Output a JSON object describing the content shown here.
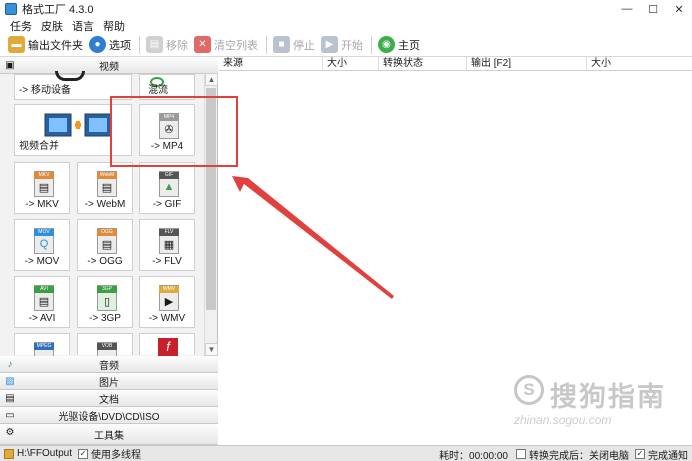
{
  "window": {
    "title": "格式工厂 4.3.0",
    "minimize": "—",
    "maximize": "☐",
    "close": "✕"
  },
  "menu": [
    "任务",
    "皮肤",
    "语言",
    "帮助"
  ],
  "toolbar": {
    "output_folder": "输出文件夹",
    "options": "选项",
    "remove": "移除",
    "clear_list": "清空列表",
    "stop": "停止",
    "start": "开始",
    "home": "主页"
  },
  "panel": {
    "categories": {
      "video": "视频",
      "audio": "音频",
      "image": "图片",
      "document": "文档",
      "optical": "光驱设备\\DVD\\CD\\ISO",
      "tools": "工具集"
    },
    "tiles": {
      "mobile": "-> 移动设备",
      "stream": "混流",
      "merge": "视频合并",
      "mp4": "-> MP4",
      "mkv": "-> MKV",
      "webm": "-> WebM",
      "gif": "-> GIF",
      "mov": "-> MOV",
      "ogg": "-> OGG",
      "flv": "-> FLV",
      "avi": "-> AVI",
      "3gp": "-> 3GP",
      "wmv": "-> WMV"
    },
    "tile_badges": {
      "mp4": "MP4",
      "mkv": "MKV",
      "webm": "WebM",
      "gif": "GIF",
      "mov": "MOV",
      "ogg": "OGG",
      "flv": "FLV",
      "avi": "AVI",
      "3gp": "3GP",
      "wmv": "WMV",
      "mpeg": "MPEG",
      "vob": "VOB"
    }
  },
  "table": {
    "columns": [
      "来源",
      "大小",
      "转换状态",
      "输出 [F2]",
      "大小"
    ]
  },
  "status": {
    "output_path": "H:\\FFOutput",
    "multithread": "使用多线程",
    "elapsed": "耗时：00:00:00",
    "after_convert": "转换完成后：关闭电脑",
    "notify": "完成通知"
  },
  "watermark": {
    "text": "搜狗指南",
    "url": "zhinan.sogou.com"
  },
  "colors": {
    "highlight": "#e0413f",
    "accent": "#3a8fd8"
  }
}
